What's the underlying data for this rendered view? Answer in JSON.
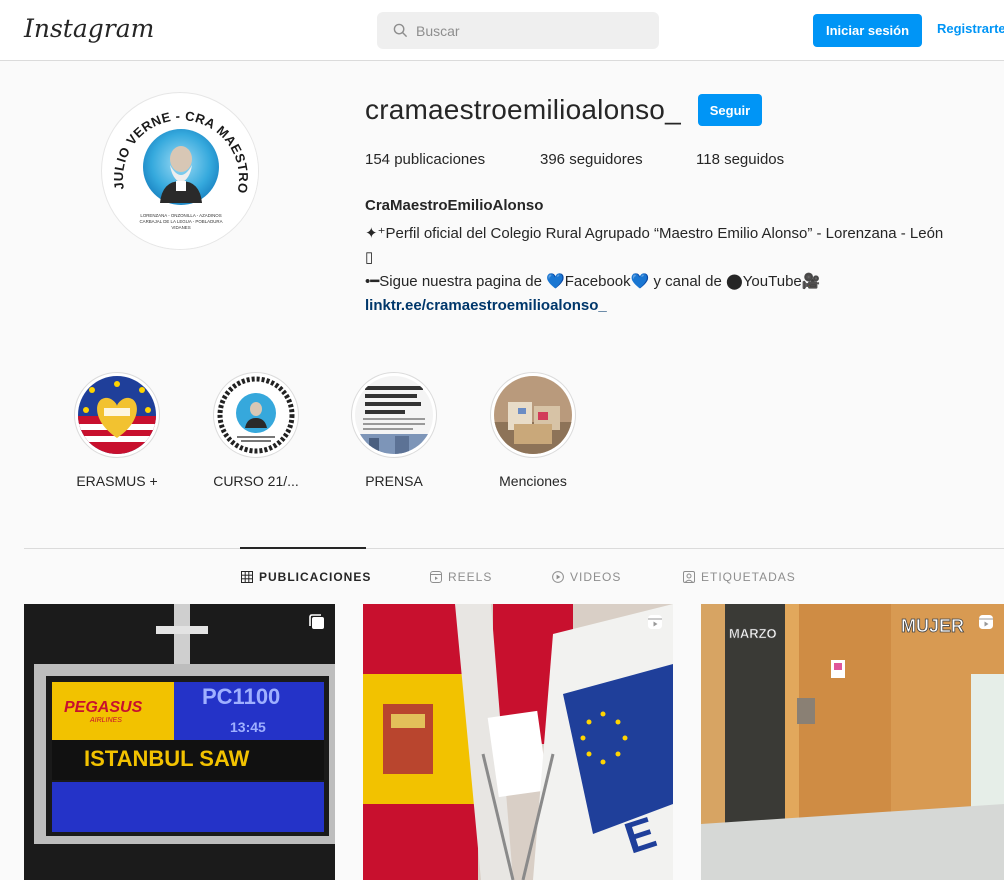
{
  "header": {
    "logo": "Instagram",
    "search_placeholder": "Buscar",
    "login_label": "Iniciar sesión",
    "register_label": "Registrarte"
  },
  "profile": {
    "username": "cramaestroemilioalonso_",
    "follow_label": "Seguir",
    "stats": [
      {
        "value": "154",
        "label": " publicaciones"
      },
      {
        "value": "396",
        "label": " seguidores"
      },
      {
        "value": "118",
        "label": " seguidos"
      }
    ],
    "full_name": "CraMaestroEmilioAlonso",
    "bio_lines": [
      "✦⁺Perfil oficial del Colegio Rural Agrupado “Maestro Emilio Alonso” - Lorenzana - León",
      "▯",
      "•━Sigue nuestra pagina de 💙Facebook💙 y canal de ⬤YouTube🎥"
    ],
    "link": "linktr.ee/cramaestroemilioalonso_",
    "avatar_ring_text": "JULIO VERNE - CRA MAESTRO EMILIO ALONSO",
    "avatar_sub_text_1": "LORENZANA - ONZONILLA - AZADINOS",
    "avatar_sub_text_2": "CARBAJAL DE LA LEGUA - POBLADURA",
    "avatar_sub_text_3": "VIDANES"
  },
  "highlights": [
    {
      "label": "ERASMUS +"
    },
    {
      "label": "CURSO 21/..."
    },
    {
      "label": "PRENSA"
    },
    {
      "label": "Menciones"
    }
  ],
  "tabs": [
    {
      "label": "PUBLICACIONES",
      "icon": "grid-icon",
      "active": true
    },
    {
      "label": "REELS",
      "icon": "reels-icon",
      "active": false
    },
    {
      "label": "VIDEOS",
      "icon": "play-icon",
      "active": false
    },
    {
      "label": "ETIQUETADAS",
      "icon": "tag-icon",
      "active": false
    }
  ],
  "posts": [
    {
      "airline": "PEGASUS",
      "airline_sub": "AIRLINES",
      "flight": "PC1100",
      "time": "13:45",
      "destination": "ISTANBUL SAW",
      "badge": "multiple-icon"
    },
    {
      "text": "E",
      "badge": "reels-icon"
    },
    {
      "sign_left": "MARZO",
      "sign_right": "MUJER",
      "badge": "reels-icon"
    }
  ],
  "colors": {
    "accent": "#0095f6",
    "link": "#00376b",
    "text": "#262626",
    "muted": "#8e8e8e"
  }
}
